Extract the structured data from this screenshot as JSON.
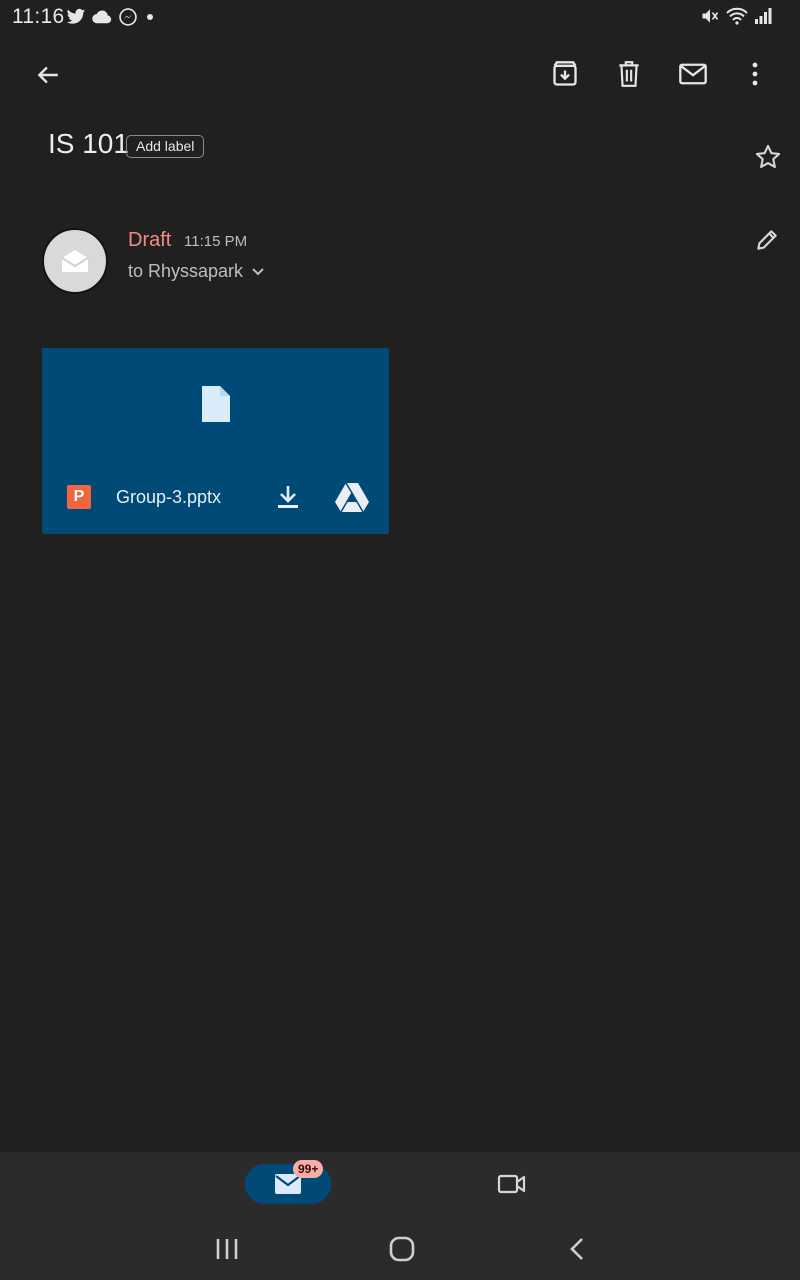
{
  "status_bar": {
    "time": "11:16",
    "left_icons": [
      "twitter-icon",
      "cloud-icon",
      "messenger-icon",
      "dot-icon"
    ],
    "right_icons": [
      "mute-icon",
      "wifi-icon",
      "signal-icon"
    ]
  },
  "toolbar": {
    "back_icon": "arrow-left-icon",
    "actions": [
      "archive-icon",
      "delete-icon",
      "mark-unread-icon",
      "more-vert-icon"
    ]
  },
  "thread": {
    "subject": "IS 101",
    "label_chip": "Add label",
    "starred": false
  },
  "message": {
    "status": "Draft",
    "time": "11:15 PM",
    "recipients": "to Rhyssapark",
    "status_color": "#f28b82"
  },
  "attachment": {
    "file_name": "Group-3.pptx",
    "type_badge": "P",
    "card_color": "#004a77",
    "badge_color": "#f0653d"
  },
  "bottom_nav": {
    "mail_badge": "99+",
    "items": [
      "mail-icon",
      "video-icon"
    ]
  },
  "system_nav": [
    "recents-icon",
    "home-icon",
    "back-icon"
  ]
}
